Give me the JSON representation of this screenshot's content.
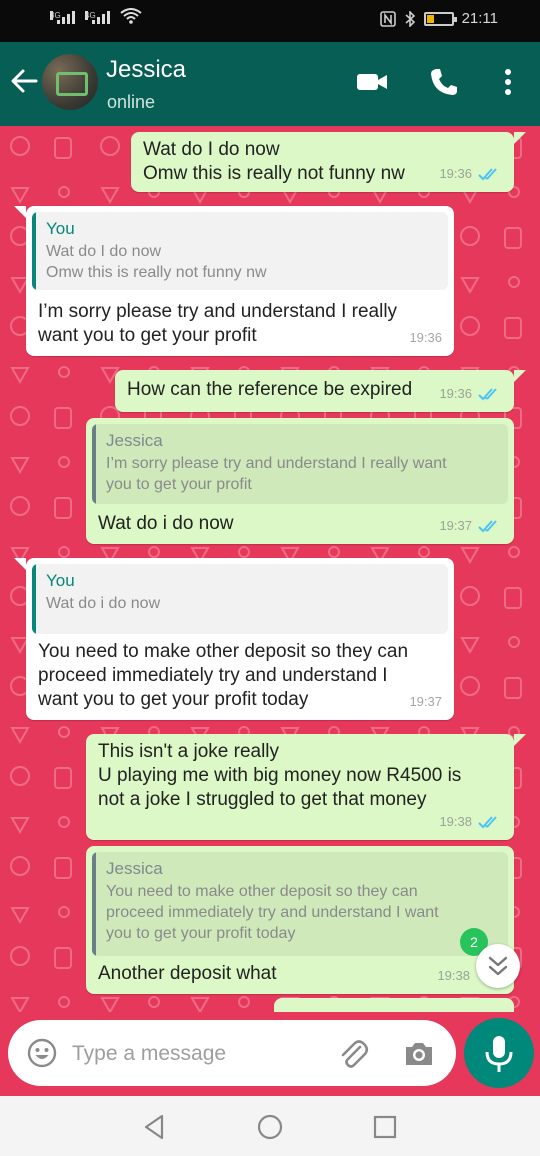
{
  "status_bar": {
    "network_sim1": "3G",
    "network_sim2": "4G",
    "time": "21:11",
    "battery_level": 0.3,
    "icons": [
      "wifi-icon",
      "nfc-icon",
      "bluetooth-icon",
      "battery-icon"
    ]
  },
  "header": {
    "contact_name": "Jessica",
    "status": "online",
    "icons": [
      "back-arrow-icon",
      "video-call-icon",
      "voice-call-icon",
      "more-options-icon"
    ]
  },
  "messages": [
    {
      "direction": "out",
      "text_lines": [
        "Wat do I do now",
        "Omw this is really not funny nw"
      ],
      "time": "19:36",
      "read": true
    },
    {
      "direction": "in",
      "quote": {
        "author": "You",
        "text_lines": [
          "Wat do I do now",
          "Omw this is really not funny nw"
        ]
      },
      "text_lines": [
        "I’m sorry please try and understand I really",
        "want you to get your profit"
      ],
      "time": "19:36"
    },
    {
      "direction": "out",
      "text_lines": [
        "How can the reference be expired"
      ],
      "time": "19:36",
      "read": true
    },
    {
      "direction": "out",
      "quote": {
        "author": "Jessica",
        "text_lines": [
          "I’m sorry please try and understand I really want",
          "you to get your profit"
        ]
      },
      "text_lines": [
        "Wat do i do now"
      ],
      "time": "19:37",
      "read": true
    },
    {
      "direction": "in",
      "quote": {
        "author": "You",
        "text_lines": [
          "Wat do i do now"
        ]
      },
      "text_lines": [
        "You need to make other deposit so they can",
        "proceed immediately try and understand I",
        "want you to get your profit today"
      ],
      "time": "19:37"
    },
    {
      "direction": "out",
      "text_lines": [
        "This isn't a joke really",
        "U playing me with big money now R4500 is",
        "not a joke I struggled to get that money"
      ],
      "time": "19:38",
      "read": true
    },
    {
      "direction": "out",
      "quote": {
        "author": "Jessica",
        "text_lines": [
          "You need to make other deposit so they can",
          "proceed immediately try and understand I want",
          "you to get your profit today"
        ]
      },
      "text_lines": [
        "Another deposit what"
      ],
      "time": "19:38",
      "read": true
    }
  ],
  "unread_count": "2",
  "composer": {
    "placeholder": "Type a message",
    "icons": [
      "emoji-icon",
      "attach-icon",
      "camera-icon",
      "mic-icon"
    ]
  },
  "nav_bar": {
    "icons": [
      "back-triangle-icon",
      "home-circle-icon",
      "recents-square-icon"
    ]
  },
  "colors": {
    "header": "#075e54",
    "chat_background": "#e6385b",
    "outgoing_bubble": "#dcf8c6",
    "incoming_bubble": "#ffffff",
    "read_ticks": "#4fc3f7",
    "mic_button": "#00897b"
  }
}
